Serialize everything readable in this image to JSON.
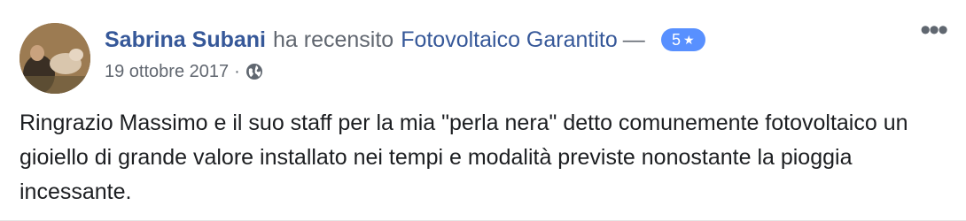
{
  "review": {
    "author": "Sabrina Subani",
    "action": "ha recensito",
    "page": "Fotovoltaico Garantito",
    "separator": "—",
    "rating_value": "5",
    "rating_star": "★",
    "date": "19 ottobre 2017",
    "dot": "·",
    "privacy_icon": "globe-icon",
    "menu": "•••",
    "text": "Ringrazio Massimo e il suo staff per la mia \"perla nera\" detto comunemente fotovoltaico un gioiello di grande valore installato nei tempi e modalità previste nonostante la pioggia incessante."
  },
  "colors": {
    "link": "#365899",
    "meta": "#616770",
    "badge": "#5890ff",
    "text": "#1c1e21"
  }
}
